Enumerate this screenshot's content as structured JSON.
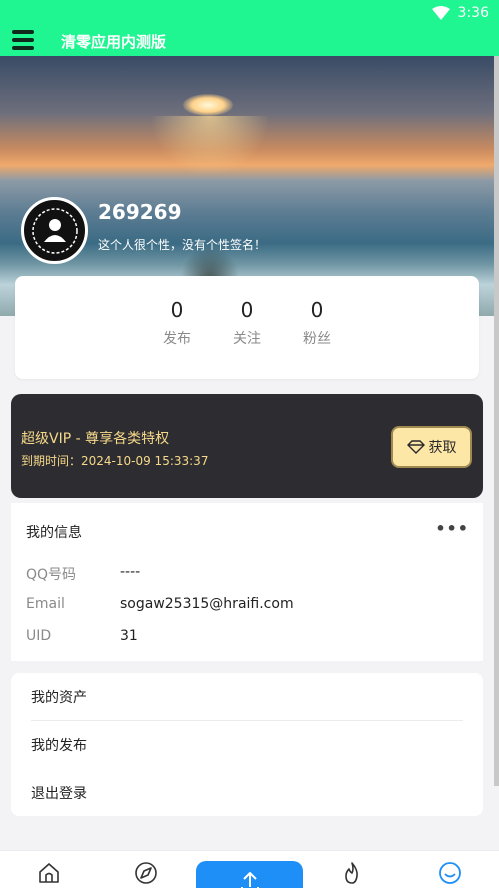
{
  "status": {
    "time": "3:36",
    "wifi_icon": "wifi-icon"
  },
  "header": {
    "title": "清零应用内测版",
    "menu_icon": "hamburger-menu-icon",
    "bg_color": "#1ff591"
  },
  "profile": {
    "username": "269269",
    "signature": "这个人很个性，没有个性签名！",
    "avatar_icon": "user-laurel-icon"
  },
  "stats": [
    {
      "value": "0",
      "label": "发布"
    },
    {
      "value": "0",
      "label": "关注"
    },
    {
      "value": "0",
      "label": "粉丝"
    }
  ],
  "vip": {
    "title": "超级VIP - 尊享各类特权",
    "expiry": "到期时间：2024-10-09 15:33:37",
    "button_label": "获取",
    "button_icon": "diamond-icon",
    "accent": "#f6d98a"
  },
  "my_info": {
    "title": "我的信息",
    "more_icon": "more-dots-icon",
    "rows": [
      {
        "label": "QQ号码",
        "value": "----"
      },
      {
        "label": "Email",
        "value": "sogaw25315@hraifi.com"
      },
      {
        "label": "UID",
        "value": "31"
      }
    ]
  },
  "menu": [
    {
      "label": "我的资产"
    },
    {
      "label": "我的发布"
    },
    {
      "label": "退出登录"
    }
  ],
  "tabbar": {
    "accent": "#1e8ff7",
    "tabs": [
      {
        "icon": "home-icon"
      },
      {
        "icon": "compass-icon"
      },
      {
        "icon": "upload-icon"
      },
      {
        "icon": "fire-icon"
      },
      {
        "icon": "smile-icon"
      }
    ]
  }
}
